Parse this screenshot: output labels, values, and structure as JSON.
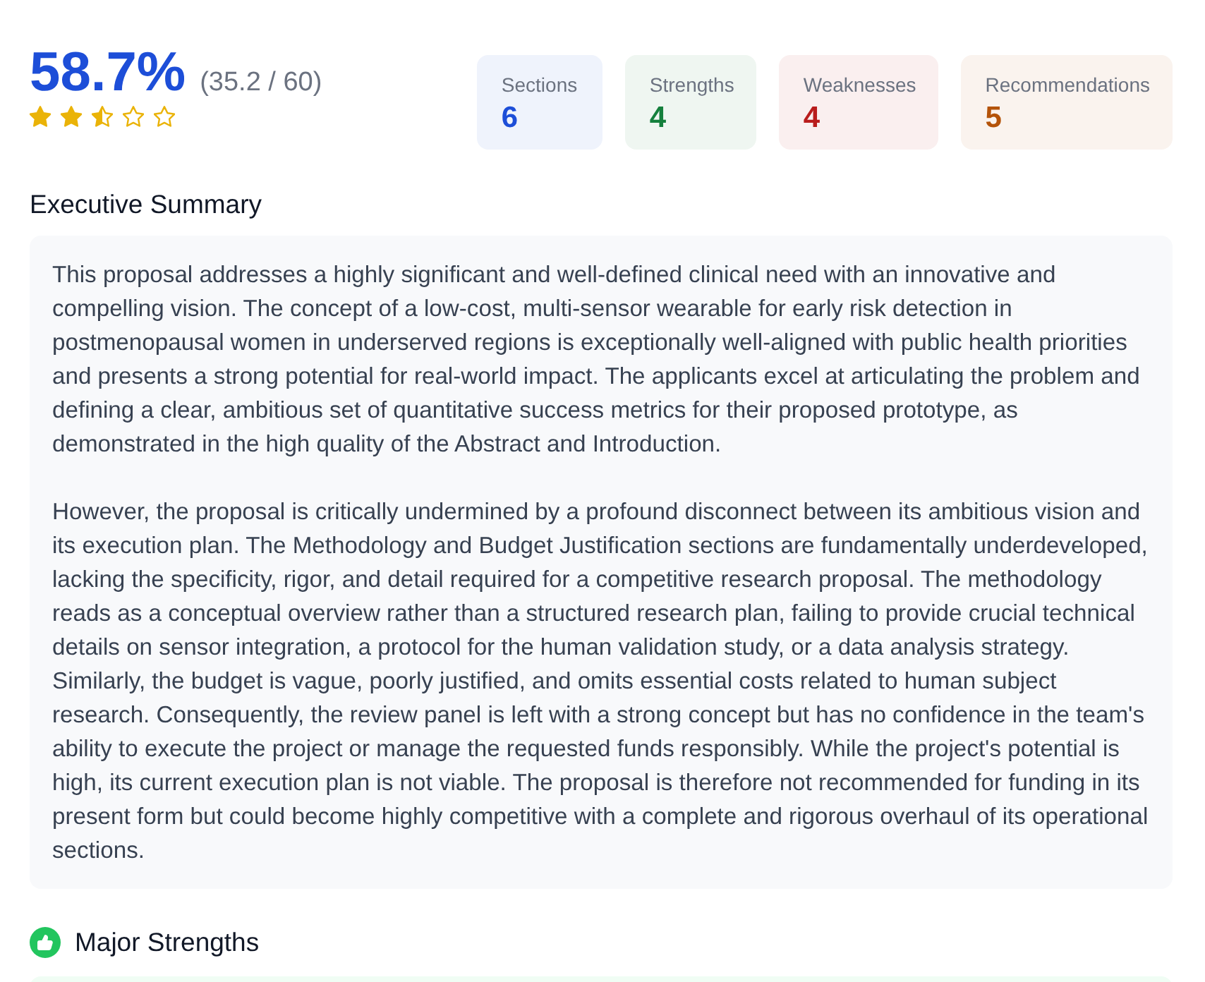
{
  "score": {
    "percent": "58.7%",
    "points": "(35.2 / 60)",
    "stars": 2.5
  },
  "stats": [
    {
      "label": "Sections",
      "value": "6",
      "color": "#1d4ed8"
    },
    {
      "label": "Strengths",
      "value": "4",
      "color": "#15803d"
    },
    {
      "label": "Weaknesses",
      "value": "4",
      "color": "#b91c1c"
    },
    {
      "label": "Recommendations",
      "value": "5",
      "color": "#b45309"
    }
  ],
  "executive_summary": {
    "title": "Executive Summary",
    "paragraphs": [
      "This proposal addresses a highly significant and well-defined clinical need with an innovative and compelling vision. The concept of a low-cost, multi-sensor wearable for early risk detection in postmenopausal women in underserved regions is exceptionally well-aligned with public health priorities and presents a strong potential for real-world impact. The applicants excel at articulating the problem and defining a clear, ambitious set of quantitative success metrics for their proposed prototype, as demonstrated in the high quality of the Abstract and Introduction.",
      "However, the proposal is critically undermined by a profound disconnect between its ambitious vision and its execution plan. The Methodology and Budget Justification sections are fundamentally underdeveloped, lacking the specificity, rigor, and detail required for a competitive research proposal. The methodology reads as a conceptual overview rather than a structured research plan, failing to provide crucial technical details on sensor integration, a protocol for the human validation study, or a data analysis strategy. Similarly, the budget is vague, poorly justified, and omits essential costs related to human subject research. Consequently, the review panel is left with a strong concept but has no confidence in the team's ability to execute the project or manage the requested funds responsibly. While the project's potential is high, its current execution plan is not viable. The proposal is therefore not recommended for funding in its present form but could become highly competitive with a complete and rigorous overhaul of its operational sections."
    ]
  },
  "major_strengths": {
    "title": "Major Strengths"
  }
}
